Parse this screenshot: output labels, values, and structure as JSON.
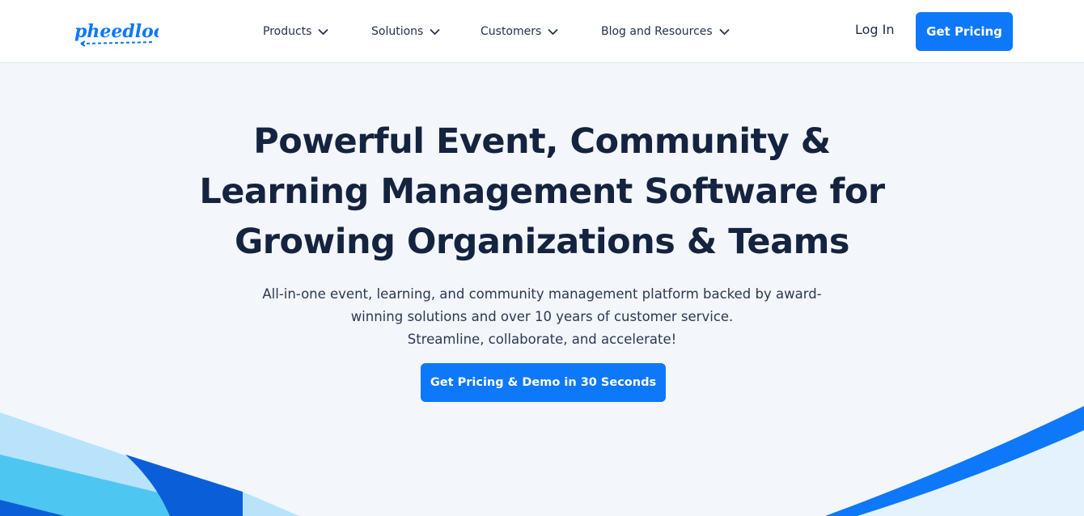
{
  "brand": {
    "logo_text": "pheedloop",
    "accent_color": "#0e78fa",
    "title_color": "#14233f"
  },
  "nav": {
    "items": [
      {
        "label": "Products",
        "icon": "chevron-down-icon"
      },
      {
        "label": "Solutions",
        "icon": "chevron-down-icon"
      },
      {
        "label": "Customers",
        "icon": "chevron-down-icon"
      },
      {
        "label": "Blog and Resources",
        "icon": "chevron-down-icon"
      }
    ],
    "login_label": "Log In",
    "pricing_label": "Get Pricing"
  },
  "hero": {
    "title_lines": [
      "Powerful Event, Community &",
      "Learning Management Software for",
      "Growing Organizations & Teams"
    ],
    "subtitle_lines": [
      "All-in-one event, learning, and community management platform backed by award-",
      "winning solutions and over 10 years of customer service.",
      "Streamline, collaborate, and accelerate!"
    ],
    "cta_label": "Get Pricing & Demo in 30 Seconds"
  }
}
